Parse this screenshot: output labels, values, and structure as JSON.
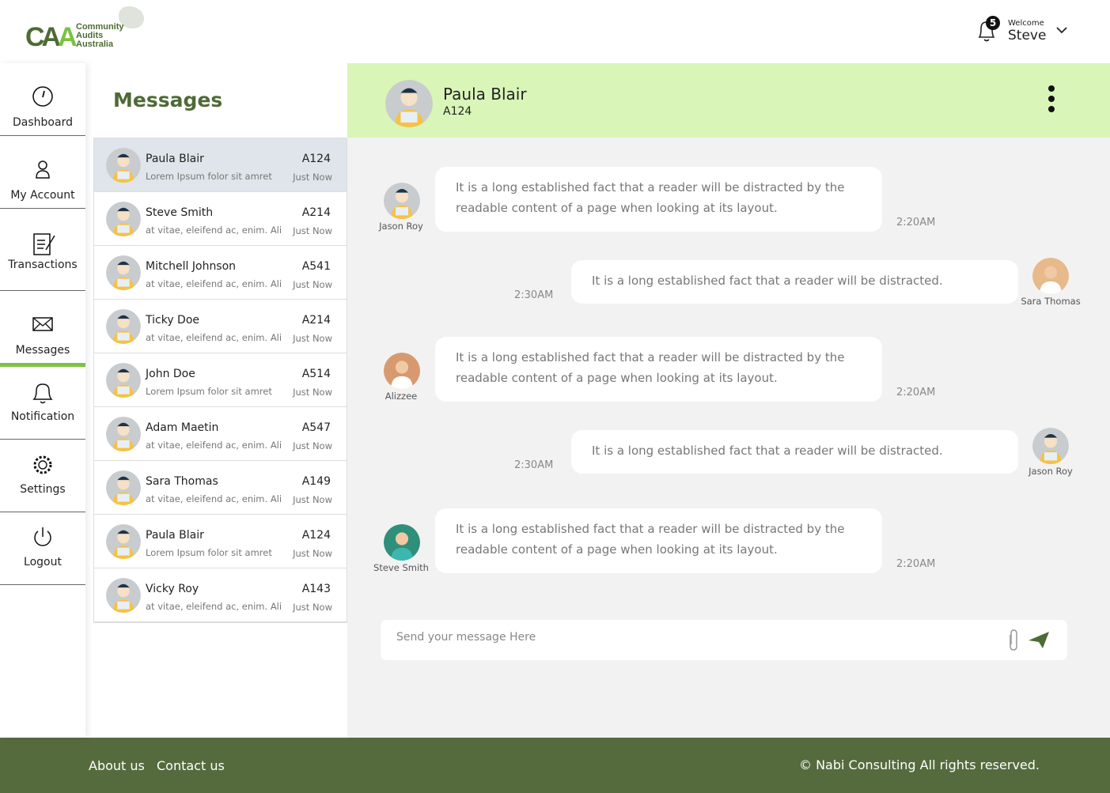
{
  "header": {
    "logo_text": [
      "Community",
      "Audits",
      "Australia"
    ],
    "logo_mark": "CAA",
    "notification_count": "5",
    "welcome": "Welcome",
    "user": "Steve"
  },
  "sidebar": {
    "items": [
      {
        "label": "Dashboard",
        "icon": "gauge-icon"
      },
      {
        "label": "My Account",
        "icon": "user-icon"
      },
      {
        "label": "Transactions",
        "icon": "document-pen-icon"
      },
      {
        "label": "Messages",
        "icon": "envelope-icon",
        "active": true
      },
      {
        "label": "Notification",
        "icon": "bell-icon"
      },
      {
        "label": "Settings",
        "icon": "gear-icon"
      },
      {
        "label": "Logout",
        "icon": "power-icon"
      }
    ]
  },
  "messages": {
    "title": "Messages",
    "list": [
      {
        "name": "Paula Blair",
        "code": "A124",
        "preview": "Lorem Ipsum folor sit amret",
        "time": "Just Now"
      },
      {
        "name": "Steve Smith",
        "code": "A214",
        "preview": "at vitae, eleifend ac, enim. Ali",
        "time": "Just Now"
      },
      {
        "name": "Mitchell Johnson",
        "code": "A541",
        "preview": "at vitae, eleifend ac, enim. Ali",
        "time": "Just Now"
      },
      {
        "name": "Ticky Doe",
        "code": "A214",
        "preview": "at vitae, eleifend ac, enim. Ali",
        "time": "Just Now"
      },
      {
        "name": "John Doe",
        "code": "A514",
        "preview": "Lorem Ipsum folor sit amret",
        "time": "Just Now"
      },
      {
        "name": "Adam Maetin",
        "code": "A547",
        "preview": "at vitae, eleifend ac, enim. Ali",
        "time": "Just Now"
      },
      {
        "name": "Sara Thomas",
        "code": "A149",
        "preview": "at vitae, eleifend ac, enim. Ali",
        "time": "Just Now"
      },
      {
        "name": "Paula Blair",
        "code": "A124",
        "preview": "Lorem Ipsum folor sit amret",
        "time": "Just Now"
      },
      {
        "name": "Vicky Roy",
        "code": "A143",
        "preview": "at vitae, eleifend ac, enim. Ali",
        "time": "Just Now"
      }
    ]
  },
  "chat": {
    "name": "Paula Blair",
    "code": "A124",
    "messages": [
      {
        "sender": "Jason Roy",
        "text": "It is a long established fact that a reader will be distracted by the readable content of a page when looking at its layout.",
        "time": "2:20AM",
        "side": "left"
      },
      {
        "sender": "Sara Thomas",
        "text": "It is a long established fact that a reader will be distracted.",
        "time": "2:30AM",
        "side": "right"
      },
      {
        "sender": "Alizzee",
        "text": "It is a long established fact that a reader will be distracted by the readable content of a page when looking at its layout.",
        "time": "2:20AM",
        "side": "left"
      },
      {
        "sender": "Jason Roy",
        "text": "It is a long established fact that a reader will be distracted.",
        "time": "2:30AM",
        "side": "right"
      },
      {
        "sender": "Steve Smith",
        "text": "It is a long established fact that a reader will be distracted by the readable content of a page when looking at its layout.",
        "time": "2:20AM",
        "side": "left"
      }
    ],
    "input_placeholder": "Send your message Here"
  },
  "footer": {
    "about": "About us",
    "contact": "Contact us",
    "copyright": "© Nabi Consulting All rights reserved."
  },
  "colors": {
    "brand_green": "#4e6b35",
    "accent_green": "#7cc242",
    "chat_header": "#d9f5b8",
    "footer": "#556b3e"
  }
}
